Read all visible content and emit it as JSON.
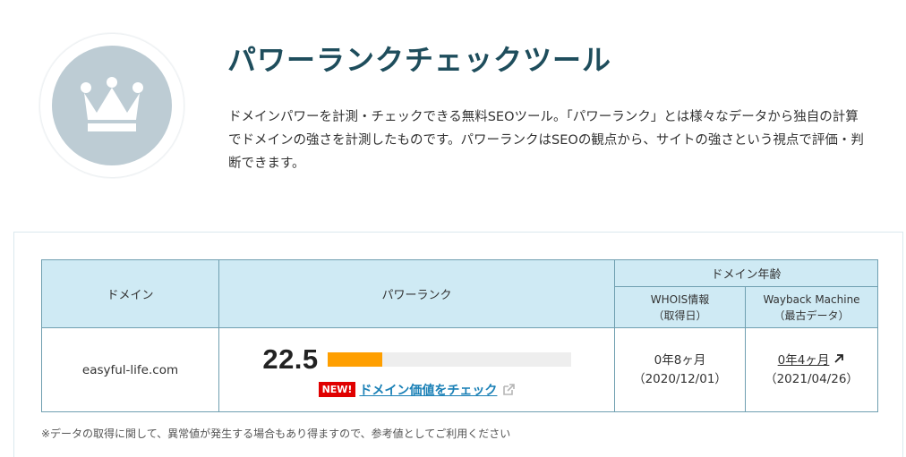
{
  "hero": {
    "icon": "crown-icon",
    "title": "パワーランクチェックツール",
    "description": "ドメインパワーを計測・チェックできる無料SEOツール。「パワーランク」とは様々なデータから独自の計算でドメインの強さを計測したものです。パワーランクはSEOの観点から、サイトの強さという視点で評価・判断できます。"
  },
  "table": {
    "headers": {
      "domain": "ドメイン",
      "power_rank": "パワーランク",
      "domain_age": "ドメイン年齢",
      "whois_line1": "WHOIS情報",
      "whois_line2": "（取得日）",
      "wayback_line1": "Wayback Machine",
      "wayback_line2": "（最古データ）"
    },
    "row": {
      "domain": "easyful-life.com",
      "rank_value": "22.5",
      "rank_bar_percent": 22.5,
      "new_badge": "NEW!",
      "check_link": "ドメイン価値をチェック",
      "whois_age": "0年8ヶ月",
      "whois_date": "（2020/12/01）",
      "wayback_age": "0年4ヶ月",
      "wayback_date": "（2021/04/26）"
    }
  },
  "footnote": "※データの取得に関して、異常値が発生する場合もあり得ますので、参考値としてご利用ください",
  "colors": {
    "accent_title": "#1e4d5c",
    "header_bg": "#cfeaf4",
    "bar_fill": "#ff9f00",
    "badge_red": "#e00000",
    "link_blue": "#1a80b6"
  }
}
